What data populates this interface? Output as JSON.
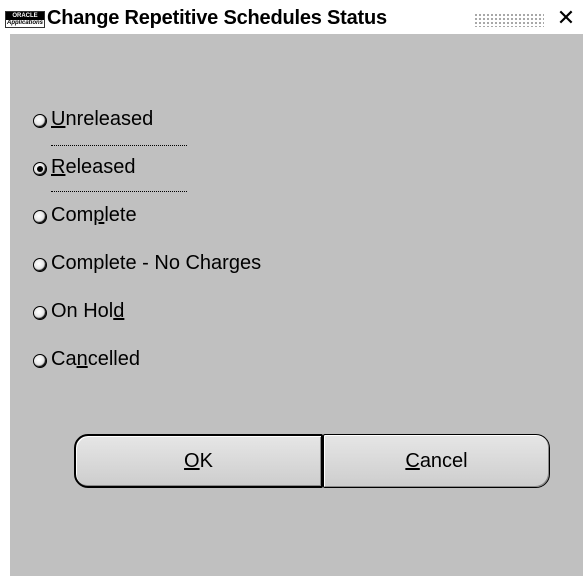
{
  "window": {
    "title": "Change Repetitive Schedules Status",
    "icon_line1": "ORACLE",
    "icon_line2": "Applications",
    "close_glyph": "✕"
  },
  "status_options": [
    {
      "label": "Unreleased",
      "selected": false
    },
    {
      "label": "Released",
      "selected": true
    },
    {
      "label": "Complete",
      "selected": false
    },
    {
      "label": "Complete - No Charges",
      "selected": false
    },
    {
      "label": "On Hold",
      "selected": false
    },
    {
      "label": "Cancelled",
      "selected": false
    }
  ],
  "buttons": {
    "ok": "OK",
    "cancel": "Cancel"
  },
  "icons": {
    "app": "oracle-applications-icon",
    "close": "close-icon",
    "grip": "title-grip-icon"
  }
}
